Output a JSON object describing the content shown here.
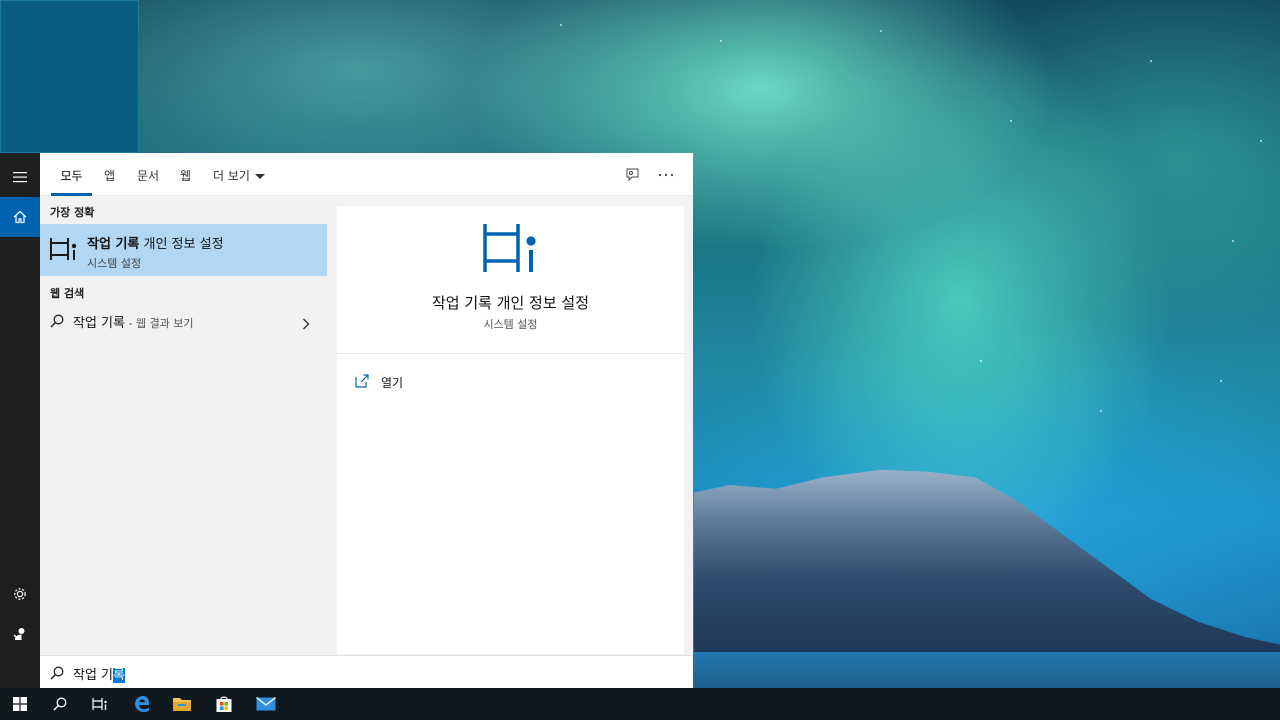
{
  "search": {
    "tabs": [
      {
        "label": "모두",
        "active": true
      },
      {
        "label": "앱",
        "active": false
      },
      {
        "label": "문서",
        "active": false
      },
      {
        "label": "웹",
        "active": false
      },
      {
        "label": "더 보기",
        "active": false
      }
    ],
    "toolbar_icons": [
      "feedback-icon",
      "more-options-icon"
    ],
    "best_match_heading": "가장 정확",
    "best_match": {
      "title_bold": "작업 기록",
      "title_rest": " 개인 정보 설정",
      "subtitle": "시스템 설정",
      "icon": "timeline-icon"
    },
    "web_heading": "웹 검색",
    "web_result": {
      "query": "작업 기록",
      "hint": " - 웹 결과 보기",
      "icon": "search-icon"
    },
    "detail": {
      "title": "작업 기록 개인 정보 설정",
      "subtitle": "시스템 설정",
      "action_label": "열기",
      "icon": "timeline-icon"
    },
    "query_text": "작업 기",
    "query_selected": "록"
  },
  "rail_icons": [
    "hamburger-icon",
    "home-icon",
    "settings-icon",
    "user-icon"
  ],
  "taskbar": {
    "icons": [
      "windows-start-icon",
      "search-icon",
      "task-view-icon",
      "edge-icon",
      "file-explorer-icon",
      "store-icon",
      "mail-icon"
    ]
  },
  "colors": {
    "accent": "#0063b1",
    "best_match_bg": "#b3d7f3",
    "rail_bg": "#1f1f1f",
    "taskbar_bg": "#101820"
  }
}
